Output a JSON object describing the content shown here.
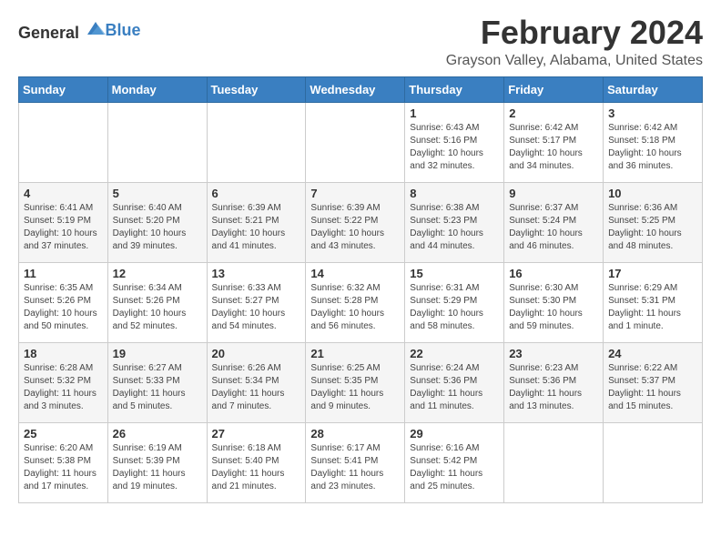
{
  "header": {
    "logo_general": "General",
    "logo_blue": "Blue",
    "month_year": "February 2024",
    "location": "Grayson Valley, Alabama, United States"
  },
  "days_of_week": [
    "Sunday",
    "Monday",
    "Tuesday",
    "Wednesday",
    "Thursday",
    "Friday",
    "Saturday"
  ],
  "weeks": [
    {
      "days": [
        {
          "number": "",
          "detail": ""
        },
        {
          "number": "",
          "detail": ""
        },
        {
          "number": "",
          "detail": ""
        },
        {
          "number": "",
          "detail": ""
        },
        {
          "number": "1",
          "detail": "Sunrise: 6:43 AM\nSunset: 5:16 PM\nDaylight: 10 hours\nand 32 minutes."
        },
        {
          "number": "2",
          "detail": "Sunrise: 6:42 AM\nSunset: 5:17 PM\nDaylight: 10 hours\nand 34 minutes."
        },
        {
          "number": "3",
          "detail": "Sunrise: 6:42 AM\nSunset: 5:18 PM\nDaylight: 10 hours\nand 36 minutes."
        }
      ]
    },
    {
      "days": [
        {
          "number": "4",
          "detail": "Sunrise: 6:41 AM\nSunset: 5:19 PM\nDaylight: 10 hours\nand 37 minutes."
        },
        {
          "number": "5",
          "detail": "Sunrise: 6:40 AM\nSunset: 5:20 PM\nDaylight: 10 hours\nand 39 minutes."
        },
        {
          "number": "6",
          "detail": "Sunrise: 6:39 AM\nSunset: 5:21 PM\nDaylight: 10 hours\nand 41 minutes."
        },
        {
          "number": "7",
          "detail": "Sunrise: 6:39 AM\nSunset: 5:22 PM\nDaylight: 10 hours\nand 43 minutes."
        },
        {
          "number": "8",
          "detail": "Sunrise: 6:38 AM\nSunset: 5:23 PM\nDaylight: 10 hours\nand 44 minutes."
        },
        {
          "number": "9",
          "detail": "Sunrise: 6:37 AM\nSunset: 5:24 PM\nDaylight: 10 hours\nand 46 minutes."
        },
        {
          "number": "10",
          "detail": "Sunrise: 6:36 AM\nSunset: 5:25 PM\nDaylight: 10 hours\nand 48 minutes."
        }
      ]
    },
    {
      "days": [
        {
          "number": "11",
          "detail": "Sunrise: 6:35 AM\nSunset: 5:26 PM\nDaylight: 10 hours\nand 50 minutes."
        },
        {
          "number": "12",
          "detail": "Sunrise: 6:34 AM\nSunset: 5:26 PM\nDaylight: 10 hours\nand 52 minutes."
        },
        {
          "number": "13",
          "detail": "Sunrise: 6:33 AM\nSunset: 5:27 PM\nDaylight: 10 hours\nand 54 minutes."
        },
        {
          "number": "14",
          "detail": "Sunrise: 6:32 AM\nSunset: 5:28 PM\nDaylight: 10 hours\nand 56 minutes."
        },
        {
          "number": "15",
          "detail": "Sunrise: 6:31 AM\nSunset: 5:29 PM\nDaylight: 10 hours\nand 58 minutes."
        },
        {
          "number": "16",
          "detail": "Sunrise: 6:30 AM\nSunset: 5:30 PM\nDaylight: 10 hours\nand 59 minutes."
        },
        {
          "number": "17",
          "detail": "Sunrise: 6:29 AM\nSunset: 5:31 PM\nDaylight: 11 hours\nand 1 minute."
        }
      ]
    },
    {
      "days": [
        {
          "number": "18",
          "detail": "Sunrise: 6:28 AM\nSunset: 5:32 PM\nDaylight: 11 hours\nand 3 minutes."
        },
        {
          "number": "19",
          "detail": "Sunrise: 6:27 AM\nSunset: 5:33 PM\nDaylight: 11 hours\nand 5 minutes."
        },
        {
          "number": "20",
          "detail": "Sunrise: 6:26 AM\nSunset: 5:34 PM\nDaylight: 11 hours\nand 7 minutes."
        },
        {
          "number": "21",
          "detail": "Sunrise: 6:25 AM\nSunset: 5:35 PM\nDaylight: 11 hours\nand 9 minutes."
        },
        {
          "number": "22",
          "detail": "Sunrise: 6:24 AM\nSunset: 5:36 PM\nDaylight: 11 hours\nand 11 minutes."
        },
        {
          "number": "23",
          "detail": "Sunrise: 6:23 AM\nSunset: 5:36 PM\nDaylight: 11 hours\nand 13 minutes."
        },
        {
          "number": "24",
          "detail": "Sunrise: 6:22 AM\nSunset: 5:37 PM\nDaylight: 11 hours\nand 15 minutes."
        }
      ]
    },
    {
      "days": [
        {
          "number": "25",
          "detail": "Sunrise: 6:20 AM\nSunset: 5:38 PM\nDaylight: 11 hours\nand 17 minutes."
        },
        {
          "number": "26",
          "detail": "Sunrise: 6:19 AM\nSunset: 5:39 PM\nDaylight: 11 hours\nand 19 minutes."
        },
        {
          "number": "27",
          "detail": "Sunrise: 6:18 AM\nSunset: 5:40 PM\nDaylight: 11 hours\nand 21 minutes."
        },
        {
          "number": "28",
          "detail": "Sunrise: 6:17 AM\nSunset: 5:41 PM\nDaylight: 11 hours\nand 23 minutes."
        },
        {
          "number": "29",
          "detail": "Sunrise: 6:16 AM\nSunset: 5:42 PM\nDaylight: 11 hours\nand 25 minutes."
        },
        {
          "number": "",
          "detail": ""
        },
        {
          "number": "",
          "detail": ""
        }
      ]
    }
  ]
}
